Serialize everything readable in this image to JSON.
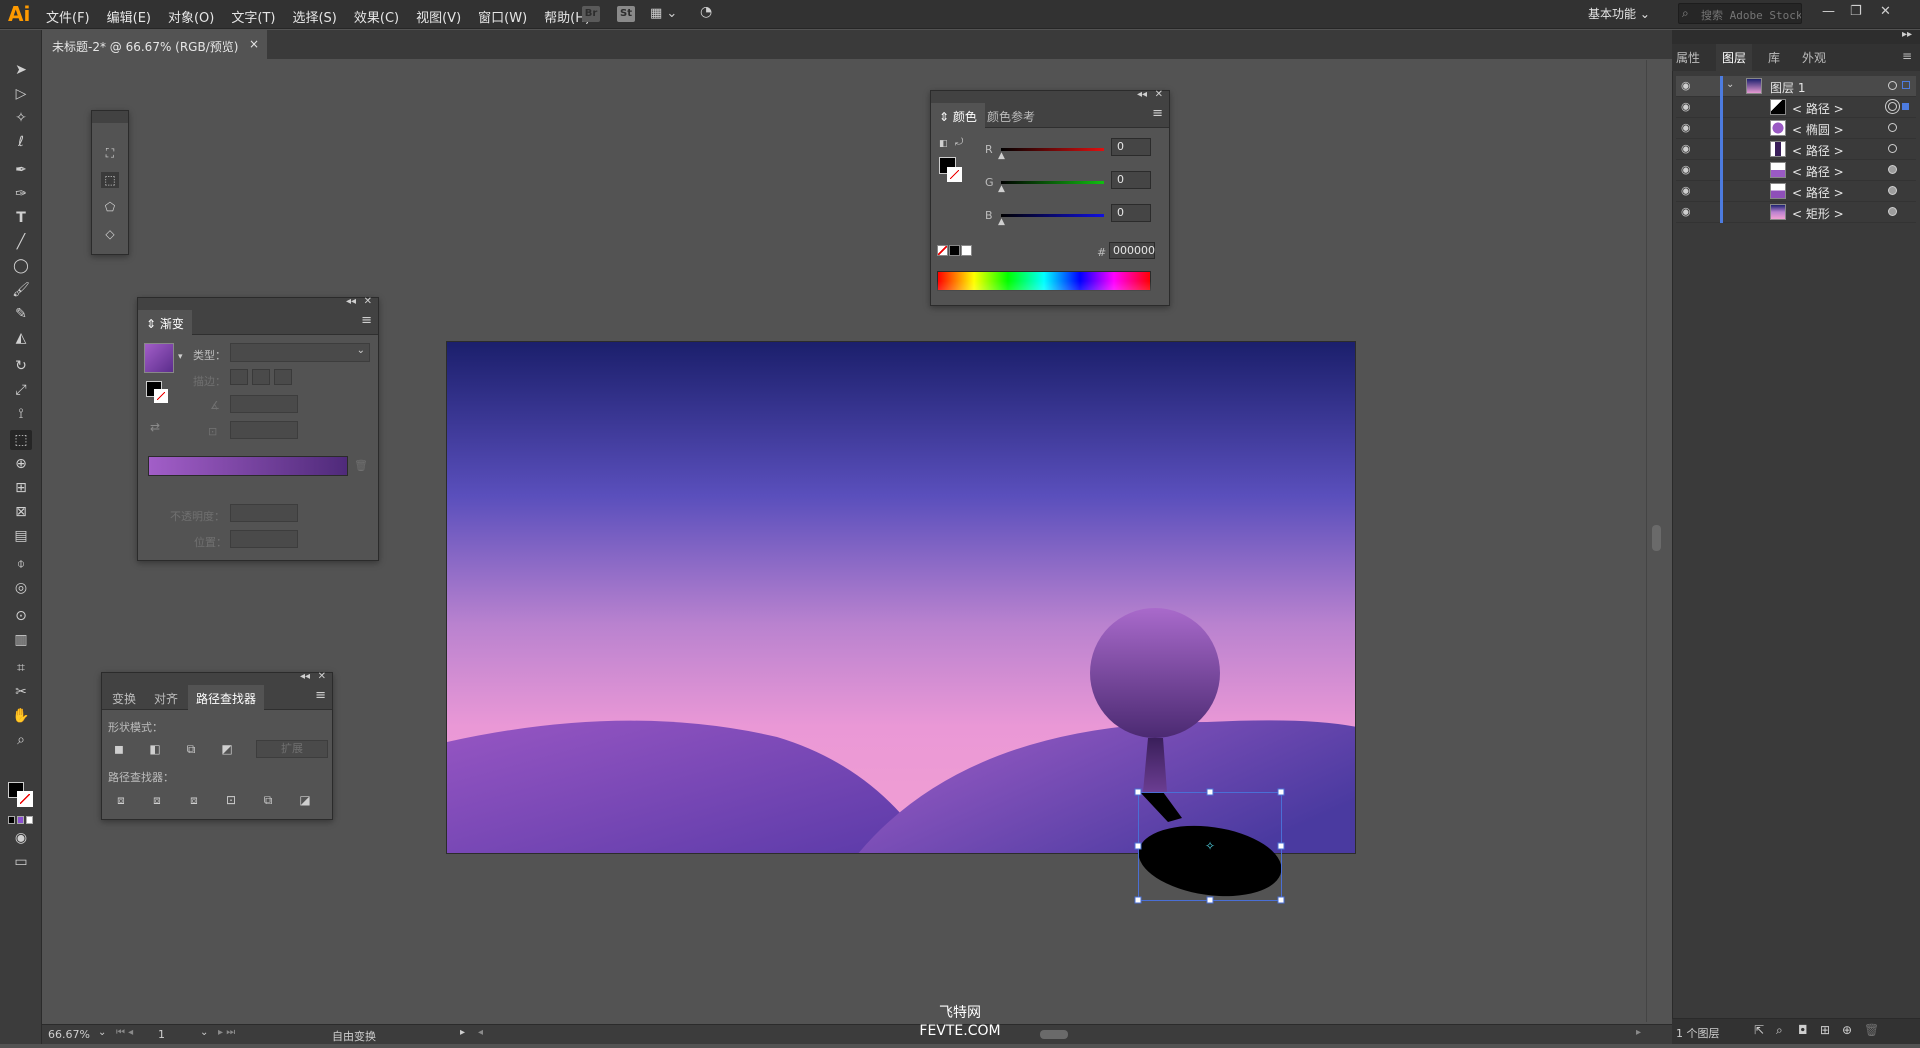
{
  "app": {
    "logo": "Ai",
    "menu": [
      "文件(F)",
      "编辑(E)",
      "对象(O)",
      "文字(T)",
      "选择(S)",
      "效果(C)",
      "视图(V)",
      "窗口(W)",
      "帮助(H)"
    ],
    "br": "Br",
    "st": "St",
    "workspace": "基本功能",
    "search_placeholder": "搜索 Adobe Stock"
  },
  "document": {
    "tab_title": "未标题-2* @ 66.67% (RGB/预览)",
    "close": "×"
  },
  "gradient_panel": {
    "title": "渐变",
    "type_label": "类型：",
    "stroke_label": "描边：",
    "opacity_label": "不透明度：",
    "position_label": "位置："
  },
  "color_panel": {
    "tabs": [
      "颜色",
      "颜色参考"
    ],
    "channels": [
      {
        "label": "R",
        "value": "0",
        "color": "#d02020"
      },
      {
        "label": "G",
        "value": "0",
        "color": "#20b020"
      },
      {
        "label": "B",
        "value": "0",
        "color": "#2020d0"
      }
    ],
    "hex_label": "#",
    "hex_value": "000000"
  },
  "pathfinder_panel": {
    "tabs": [
      "变换",
      "对齐",
      "路径查找器"
    ],
    "shape_modes_label": "形状模式：",
    "expand_label": "扩展",
    "pathfinders_label": "路径查找器："
  },
  "layers_panel": {
    "tabs": [
      "属性",
      "图层",
      "库",
      "外观"
    ],
    "layers": [
      {
        "name": "图层 1",
        "level": 0
      },
      {
        "name": "< 路径 >",
        "level": 1
      },
      {
        "name": "< 椭圆 >",
        "level": 1
      },
      {
        "name": "< 路径 >",
        "level": 1
      },
      {
        "name": "< 路径 >",
        "level": 1
      },
      {
        "name": "< 路径 >",
        "level": 1
      },
      {
        "name": "< 矩形 >",
        "level": 1
      }
    ],
    "footer_count": "1 个图层"
  },
  "status": {
    "zoom": "66.67%",
    "page": "1",
    "tool": "自由变换"
  },
  "watermark": {
    "line1": "飞特网",
    "line2": "FEVTE.COM"
  },
  "colors": {
    "accent": "#4d7ce0",
    "sky_top": "#1d2170",
    "sky_mid": "#5b4fb8",
    "horizon": "#e69ad2",
    "hill": "#8e4fb8",
    "selection": "#4a6fd6"
  }
}
